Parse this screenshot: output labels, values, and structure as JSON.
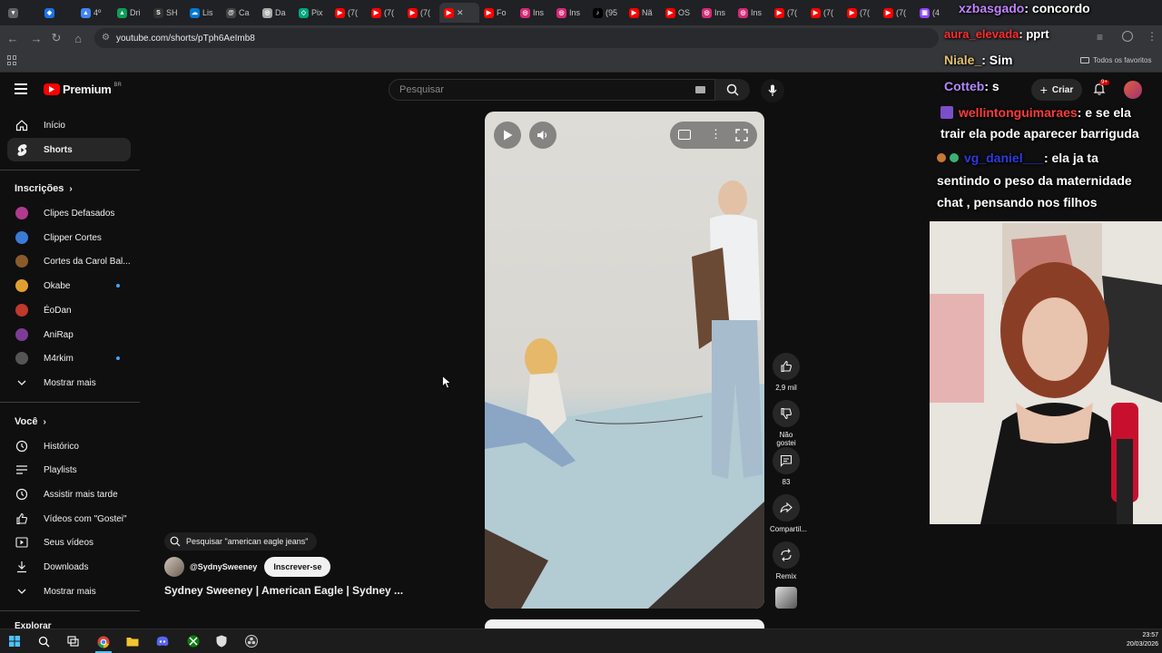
{
  "browser": {
    "tabs": [
      {
        "label": "",
        "color": "#5f6368",
        "glyph": "▾"
      },
      {
        "label": "",
        "color": "#1a73e8",
        "glyph": "◆"
      },
      {
        "label": "4º",
        "color": "#4285f4",
        "glyph": "▲"
      },
      {
        "label": "Dri",
        "color": "#0f9d58",
        "glyph": "▲"
      },
      {
        "label": "SH",
        "color": "#333333",
        "glyph": "S"
      },
      {
        "label": "Lis",
        "color": "#0078d4",
        "glyph": "☁"
      },
      {
        "label": "Ca",
        "color": "#444444",
        "glyph": "@"
      },
      {
        "label": "Da",
        "color": "#aaaaaa",
        "glyph": "◎"
      },
      {
        "label": "Pix",
        "color": "#00a67e",
        "glyph": "◇"
      },
      {
        "label": "(7(",
        "color": "#ff0000",
        "glyph": "▶"
      },
      {
        "label": "(7(",
        "color": "#ff0000",
        "glyph": "▶"
      },
      {
        "label": "(7(",
        "color": "#ff0000",
        "glyph": "▶"
      },
      {
        "label": "✕",
        "color": "#ff0000",
        "glyph": "▶",
        "active": true
      },
      {
        "label": "Fo",
        "color": "#ff0000",
        "glyph": "▶"
      },
      {
        "label": "Ins",
        "color": "#d62976",
        "glyph": "◎"
      },
      {
        "label": "Ins",
        "color": "#d62976",
        "glyph": "◎"
      },
      {
        "label": "(95",
        "color": "#000000",
        "glyph": "♪"
      },
      {
        "label": "Nã",
        "color": "#ff0000",
        "glyph": "▶"
      },
      {
        "label": "OS",
        "color": "#ff0000",
        "glyph": "▶"
      },
      {
        "label": "Ins",
        "color": "#d62976",
        "glyph": "◎"
      },
      {
        "label": "Ins",
        "color": "#d62976",
        "glyph": "◎"
      },
      {
        "label": "(7(",
        "color": "#ff0000",
        "glyph": "▶"
      },
      {
        "label": "(7(",
        "color": "#ff0000",
        "glyph": "▶"
      },
      {
        "label": "(7(",
        "color": "#ff0000",
        "glyph": "▶"
      },
      {
        "label": "(7(",
        "color": "#ff0000",
        "glyph": "▶"
      },
      {
        "label": "(4",
        "color": "#9146ff",
        "glyph": "▣"
      }
    ],
    "url": "youtube.com/shorts/pTph6AeImb8",
    "bookmarks_all": "Todos os favoritos"
  },
  "youtube": {
    "logo_text": "Premium",
    "logo_region": "BR",
    "search_placeholder": "Pesquisar",
    "create_label": "Criar",
    "notif_count": "9+",
    "sidebar": {
      "top": [
        {
          "label": "Início",
          "icon": "home-icon",
          "active": false
        },
        {
          "label": "Shorts",
          "icon": "shorts-icon",
          "active": true
        }
      ],
      "subs_header": "Inscrições",
      "subs": [
        {
          "label": "Clipes Defasados",
          "color": "#b03a8f",
          "dot": false
        },
        {
          "label": "Clipper Cortes",
          "color": "#3a7bd5",
          "dot": false
        },
        {
          "label": "Cortes da Carol Bal...",
          "color": "#8b5a2b",
          "dot": false
        },
        {
          "label": "Okabe",
          "color": "#e0a030",
          "dot": true
        },
        {
          "label": "ÉoDan",
          "color": "#c0392b",
          "dot": false
        },
        {
          "label": "AniRap",
          "color": "#7d3c98",
          "dot": false
        },
        {
          "label": "M4rkim",
          "color": "#555555",
          "dot": true
        }
      ],
      "subs_more": "Mostrar mais",
      "you_header": "Você",
      "you": [
        {
          "label": "Histórico",
          "icon": "history-icon"
        },
        {
          "label": "Playlists",
          "icon": "playlists-icon"
        },
        {
          "label": "Assistir mais tarde",
          "icon": "watch-later-icon"
        },
        {
          "label": "Vídeos com \"Gostei\"",
          "icon": "like-icon"
        },
        {
          "label": "Seus vídeos",
          "icon": "your-videos-icon"
        },
        {
          "label": "Downloads",
          "icon": "download-icon"
        }
      ],
      "you_more": "Mostrar mais",
      "explore_header": "Explorar"
    },
    "short": {
      "search_suggestion": "Pesquisar \"american eagle jeans\"",
      "channel": "@SydnySweeney",
      "subscribe": "Inscrever-se",
      "title": "Sydney Sweeney | American Eagle | Sydney ..."
    },
    "actions": [
      {
        "label": "2,9 mil",
        "icon": "like-icon"
      },
      {
        "label": "Não gostei",
        "icon": "dislike-icon"
      },
      {
        "label": "83",
        "icon": "comment-icon"
      },
      {
        "label": "Compartil...",
        "icon": "share-icon"
      },
      {
        "label": "Remix",
        "icon": "remix-icon"
      }
    ]
  },
  "stream_chat": [
    {
      "user": "xzbasgado",
      "user_color": "#c084fc",
      "text": ": concordo"
    },
    {
      "user": "aura_elevada",
      "user_color": "#ff2d2d",
      "text": ": pprt"
    },
    {
      "user": "Niale_",
      "user_color": "#e0c070",
      "text": ": Sim"
    },
    {
      "user": "Cotteb",
      "user_color": "#b388ff",
      "text": ": s"
    },
    {
      "user": "wellintonguimaraes",
      "user_color": "#ff3b3b",
      "text": ": e se ela"
    },
    {
      "user": "",
      "user_color": "#ffffff",
      "text": "trair ela pode aparecer barriguda"
    },
    {
      "user": "vg_daniel___",
      "user_color": "#2d3ae0",
      "text": ": ela ja ta"
    },
    {
      "user": "",
      "user_color": "#ffffff",
      "text": "sentindo o peso da maternidade"
    },
    {
      "user": "",
      "user_color": "#ffffff",
      "text": "chat , pensando nos filhos"
    }
  ],
  "taskbar": {
    "time": "23:57",
    "date": "20/03/2026"
  }
}
